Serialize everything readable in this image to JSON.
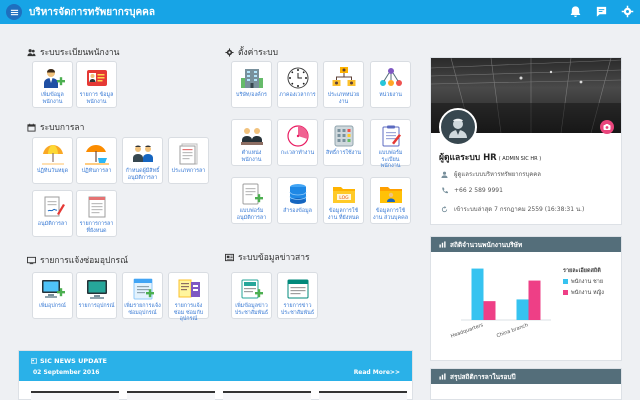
{
  "header": {
    "title": "บริหารจัดการทรัพยากรบุคคล"
  },
  "sections": {
    "employee": "ระบบระเบียนพนักงาน",
    "leave": "ระบบการลา",
    "equipment": "รายการแจ้งซ่อมอุปกรณ์",
    "settings": "ตั้งค่าระบบ",
    "news": "ระบบข้อมูลข่าวสาร"
  },
  "tiles": {
    "add_employee": "เพิ่มข้อมูล พนักงาน",
    "employee_list": "รายการ ข้อมูลพนักงาน",
    "leave_request": "ปฏิทินวันหยุด",
    "leave_calendar": "ปฏิทินการลา",
    "leave_approver": "กำหนดผู้มีสิทธิ์ อนุมัติการลา",
    "leave_type": "ประเภทการลา",
    "leave_approve": "อนุมัติการลา",
    "leave_list": "รายการการลา ที่ยังหนด",
    "add_equipment": "เพิ่มอุปกรณ์",
    "equipment_list": "รายการอุปกรณ์",
    "add_repair": "เพิ่มรายการแจ้ง ซ่อมอุปกรณ์",
    "repair_list": "รายการแจ้งซ่อม ซ่อมกับ อุปกรณ์",
    "company": "บริษัท/องค์กร",
    "time_setting": "ภาคองเวลาการ",
    "department": "ประเภทหน่วยงาน",
    "unit": "หน่วยงาน",
    "position": "ตำแหน่งพนักงาน",
    "work_time": "กะเวลาทำงาน",
    "permission": "สิทธิ์การใช้งาน",
    "emp_type": "แบบฟอร์ม ระเบียนพนักงาน",
    "form_setting": "แบบฟอร์ม อนุมัติการลา",
    "backup": "สำรองข้อมูล",
    "usage_log": "ข้อมูลการใช้งาน ที่ยังหนด",
    "personal_log": "ข้อมูลการใช้งาน ส่วนบุคคล",
    "add_news": "เพิ่มข้อมูลข่าว ประชาสัมพันธ์",
    "news_list": "รายการข่าว ประชาสัมพันธ์"
  },
  "profile": {
    "name": "ผู้ดูแลระบบ HR",
    "role": "( ADMIN SIC HR )",
    "org": "ผู้ดูแลระบบบริหารทรัพยากรบุคคล",
    "phone": "+66 2 589 9991",
    "last_login": "เข้าระบบล่าสุด 7 กรกฎาคม 2559 (16:38:31 น.)"
  },
  "stats": {
    "title": "สถิติจำนวนพนักงานบริษัท"
  },
  "stats2": {
    "title": "สรุปสถิติการลาในรอบปี"
  },
  "chart_data": {
    "type": "bar",
    "categories": [
      "Headquarters",
      "China branch"
    ],
    "series": [
      {
        "name": "พนักงาน ชาย",
        "values": [
          30,
          12
        ],
        "color": "#36c3f0"
      },
      {
        "name": "พนักงาน หญิง",
        "values": [
          11,
          23
        ],
        "color": "#ee3f86"
      }
    ],
    "legend_title": "รายละเอียดสถิติ",
    "ylim": [
      0,
      35
    ],
    "legend_position": "right"
  },
  "news": {
    "title": "SIC NEWS UPDATE",
    "date": "02 September 2016",
    "more": "Read More>>"
  },
  "colors": {
    "header": "#17a4e6",
    "panel_head": "#546e7a",
    "accent_pink": "#e9457c"
  }
}
